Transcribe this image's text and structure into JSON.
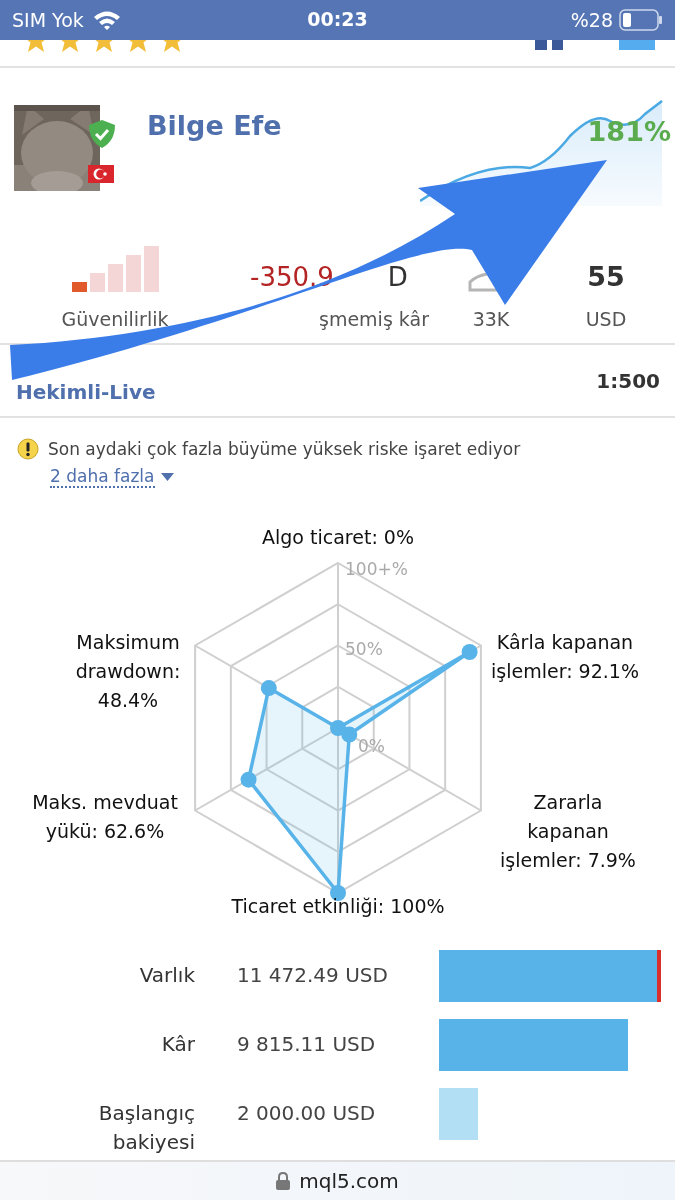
{
  "status_bar": {
    "carrier": "SIM Yok",
    "time": "00:23",
    "battery": "%28"
  },
  "profile": {
    "name": "Bilge Efe",
    "growth": "181%"
  },
  "stats": {
    "reliability": {
      "label": "Güvenilirlik",
      "level": 0.2
    },
    "profit": {
      "value": "-350.9",
      "value_tail": "D",
      "label_tail": "şmemiş kâr"
    },
    "subscribers": {
      "label": "33K"
    },
    "price": {
      "value": "55",
      "label": "USD"
    }
  },
  "account": {
    "name": "Hekimli-Live",
    "leverage": "1:500"
  },
  "warning": {
    "text": "Son aydaki çok fazla büyüme yüksek riske işaret ediyor",
    "more": "2 daha fazla"
  },
  "radar": {
    "ticks": [
      "100+%",
      "50%",
      "0%"
    ],
    "axes": [
      {
        "label": "Algo ticaret: 0%"
      },
      {
        "label": "Maksimum drawdown: 48.4%"
      },
      {
        "label": "Kârla kapanan işlemler: 92.1%"
      },
      {
        "label": "Maks. mevduat yükü: 62.6%"
      },
      {
        "label": "Zararla kapanan işlemler: 7.9%"
      },
      {
        "label": "Ticaret etkinliği: 100%"
      }
    ]
  },
  "balances": [
    {
      "label": "Varlık",
      "value": "11 472.49 USD",
      "color": "#58b3e8",
      "marker": true
    },
    {
      "label": "Kâr",
      "value": "9 815.11 USD",
      "color": "#58b3e8",
      "marker": false
    },
    {
      "label": "Başlangıç bakiyesi",
      "value": "2 000.00 USD",
      "color": "#b3dff5",
      "marker": false
    }
  ],
  "url_bar": {
    "domain": "mql5.com"
  }
}
